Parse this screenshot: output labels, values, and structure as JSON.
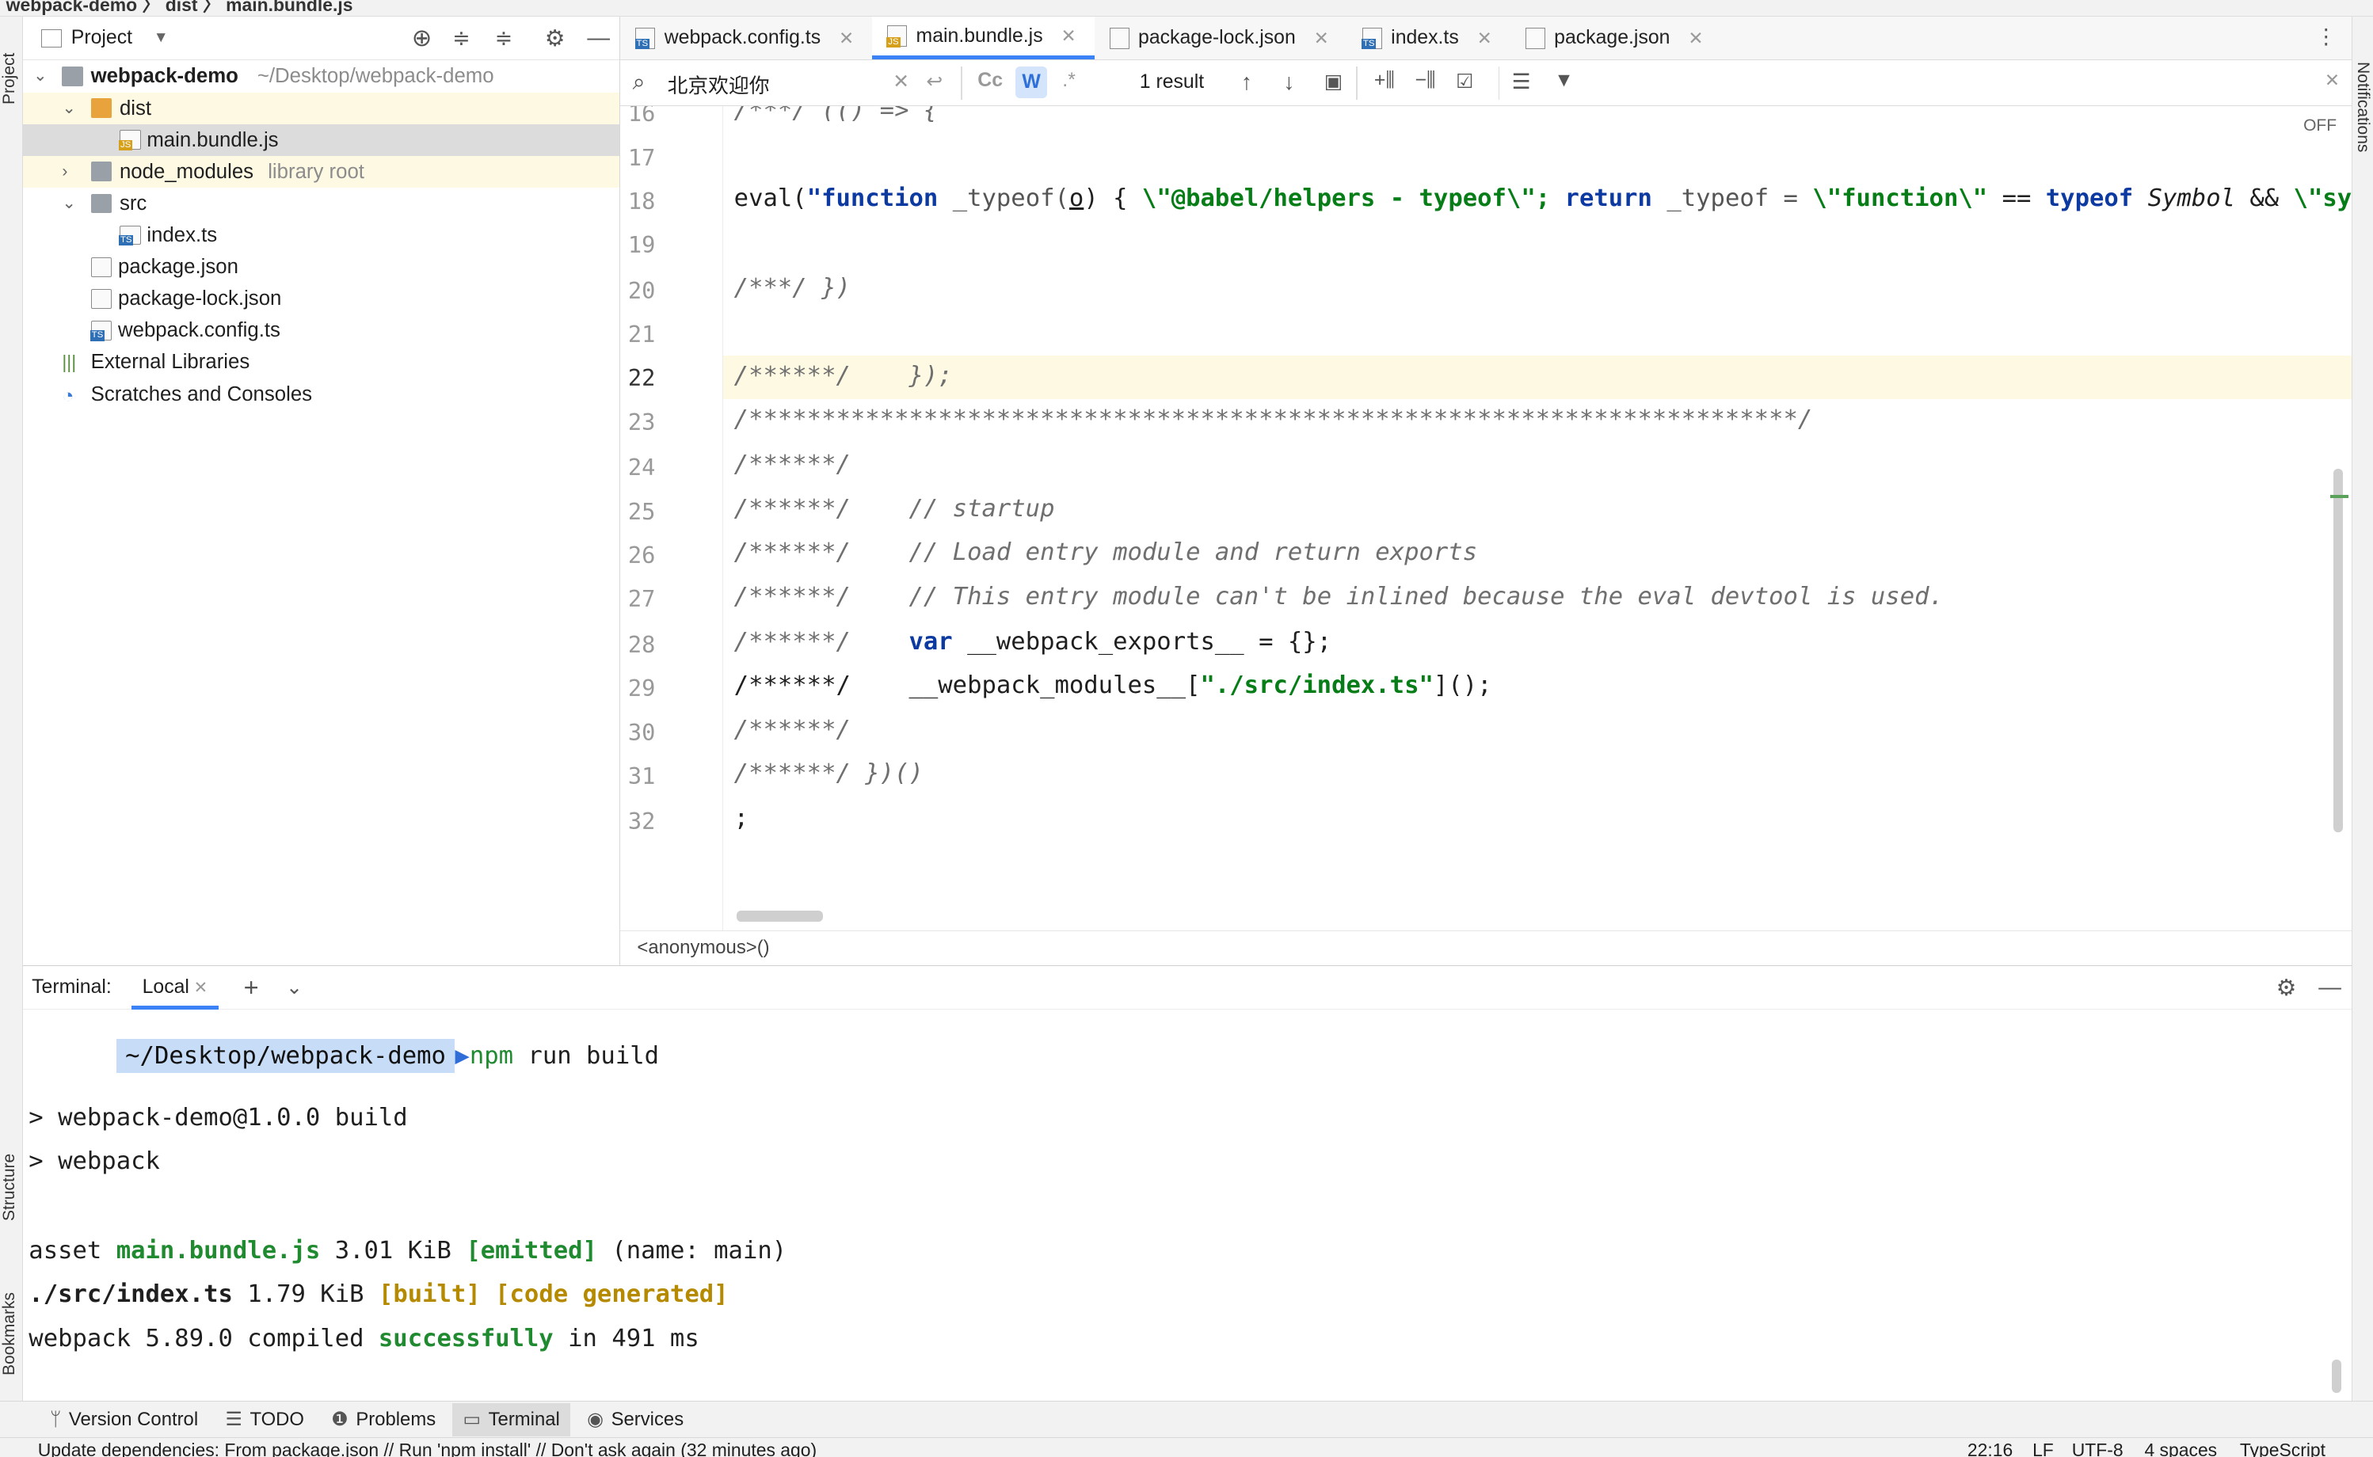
{
  "window": {
    "breadcrumb": "webpack-demo 〉 dist 〉 main.bundle.js"
  },
  "left_stripe": {
    "project": "Project",
    "structure": "Structure",
    "bookmarks": "Bookmarks"
  },
  "right_stripe": {
    "notifications": "Notifications"
  },
  "project_panel": {
    "title": "Project",
    "tree": [
      {
        "label": "webpack-demo",
        "hint": "~/Desktop/webpack-demo"
      },
      {
        "label": "dist"
      },
      {
        "label": "main.bundle.js"
      },
      {
        "label": "node_modules",
        "hint": "library root"
      },
      {
        "label": "src"
      },
      {
        "label": "index.ts"
      },
      {
        "label": "package.json"
      },
      {
        "label": "package-lock.json"
      },
      {
        "label": "webpack.config.ts"
      },
      {
        "label": "External Libraries"
      },
      {
        "label": "Scratches and Consoles"
      }
    ]
  },
  "tabs": [
    {
      "label": "webpack.config.ts",
      "badge": "TS"
    },
    {
      "label": "main.bundle.js",
      "badge": "JS",
      "active": true
    },
    {
      "label": "package-lock.json",
      "badge": "{}"
    },
    {
      "label": "index.ts",
      "badge": "TS"
    },
    {
      "label": "package.json",
      "badge": "{}"
    }
  ],
  "search": {
    "query": "北京欢迎你",
    "result": "1 result",
    "cc": "Cc",
    "w": "W",
    "regex": ".*"
  },
  "editor": {
    "off_label": "OFF",
    "line_numbers": [
      "16",
      "17",
      "18",
      "19",
      "20",
      "21",
      "22",
      "23",
      "24",
      "25",
      "26",
      "27",
      "28",
      "29",
      "30",
      "31",
      "32"
    ],
    "lines": {
      "l16": "/***/ (() => {",
      "l18_a": "eval(",
      "l18_b": "\"function",
      "l18_c": " _typeof(",
      "l18_d": "o",
      "l18_e": ") { ",
      "l18_f": "\\\"@babel/helpers - typeof\\\";",
      "l18_g": " return",
      "l18_h": " _typeof = ",
      "l18_i": "\\\"function\\\"",
      "l18_j": " == ",
      "l18_k": "typeof",
      "l18_l": " Symbol",
      "l18_m": " && ",
      "l18_n": "\\\"symbol",
      "l20": "/***/ })",
      "l22": "/******/    });",
      "l23": "/************************************************************************/",
      "l24": "/******/",
      "l25_a": "/******/    ",
      "l25_b": "// startup",
      "l26_a": "/******/    ",
      "l26_b": "// Load entry module and return exports",
      "l27_a": "/******/    ",
      "l27_b": "// This entry module can't be inlined because the eval devtool is used.",
      "l28_a": "/******/    ",
      "l28_b": "var",
      "l28_c": " __webpack_exports__ = {};",
      "l29_a": "/******/    __webpack_modules__[",
      "l29_b": "\"./src/index.ts\"",
      "l29_c": "]();",
      "l30": "/******/",
      "l31": "/******/ })()",
      "l32": ";"
    },
    "breadcrumb": "<anonymous>()"
  },
  "terminal": {
    "title": "Terminal:",
    "tab": "Local",
    "prompt_path": "~/Desktop/webpack-demo",
    "cmd_npm": "npm",
    "cmd_rest": " run build",
    "out1": "> webpack-demo@1.0.0 build",
    "out2": "> webpack",
    "asset_a": "asset ",
    "asset_b": "main.bundle.js",
    "asset_c": " 3.01 KiB ",
    "asset_d": "[emitted]",
    "asset_e": " (name: main)",
    "src_a": "./src/index.ts",
    "src_b": " 1.79 KiB ",
    "src_c": "[built] [code generated]",
    "done_a": "webpack 5.89.0 compiled ",
    "done_b": "successfully",
    "done_c": " in 491 ms"
  },
  "toolwindows": [
    "Version Control",
    "TODO",
    "Problems",
    "Terminal",
    "Services"
  ],
  "status": {
    "message": "Update dependencies: From package.json // Run 'npm install' // Don't ask again (32 minutes ago)",
    "position": "22:16",
    "line_sep": "LF",
    "encoding": "UTF-8",
    "indent": "4 spaces",
    "lang": "TypeScript"
  }
}
